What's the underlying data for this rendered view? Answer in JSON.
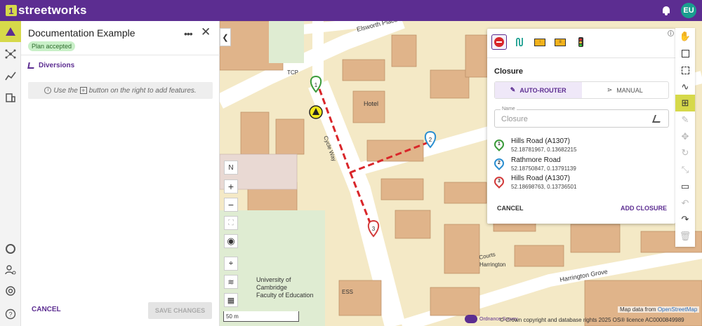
{
  "app": {
    "brand": "streetworks",
    "brand_mark": "1",
    "user_initials": "EU"
  },
  "panel": {
    "title": "Documentation Example",
    "status_badge": "Plan accepted",
    "diversions_label": "Diversions",
    "hint_pre": "Use the",
    "hint_post": "button on the right to add features.",
    "cancel_label": "CANCEL",
    "save_label": "SAVE CHANGES"
  },
  "map": {
    "labels": {
      "elsworth": "Elsworth Place",
      "tcp": "TCP",
      "hotel": "Hotel",
      "cycleway": "Cycle Way",
      "university": "University of",
      "cambridge": "Cambridge",
      "faculty": "Faculty of Education",
      "ess": "ESS",
      "harrington_grove": "Harrington Grove",
      "harrington": "Harrington",
      "courts": "Courts"
    },
    "scale_label": "50 m",
    "compass": "N",
    "attribution_pre": "Map data from",
    "attribution_link": "OpenStreetMap",
    "copyright": "© Crown copyright and database rights 2025 OS® licence AC0000849989",
    "os_label": "Ordnance Survey"
  },
  "card": {
    "section_title": "Closure",
    "mode_auto": "AUTO-ROUTER",
    "mode_manual": "MANUAL",
    "name_label": "Name",
    "name_placeholder": "Closure",
    "waypoints": [
      {
        "num": "1",
        "name": "Hills Road (A1307)",
        "coords": "52.18781967, 0.13682215",
        "color": "#3a9a3a"
      },
      {
        "num": "2",
        "name": "Rathmore Road",
        "coords": "52.18750847, 0.13791139",
        "color": "#2a8ed0"
      },
      {
        "num": "3",
        "name": "Hills Road (A1307)",
        "coords": "52.18698763, 0.13736501",
        "color": "#d23a3a"
      }
    ],
    "cancel_label": "CANCEL",
    "add_label": "ADD CLOSURE"
  },
  "colors": {
    "brand": "#5c2d91",
    "accent": "#d6d94a"
  }
}
